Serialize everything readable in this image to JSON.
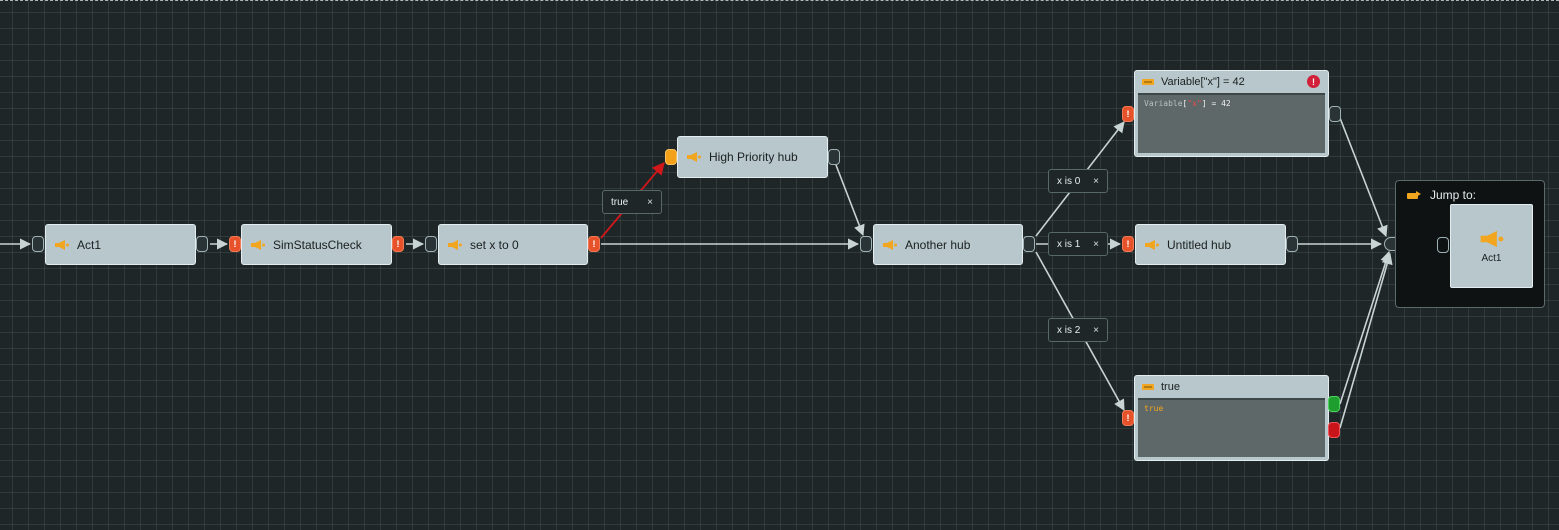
{
  "nodes": {
    "act1": "Act1",
    "sim_status_check": "SimStatusCheck",
    "set_x_to_0": "set x to 0",
    "high_priority_hub": "High Priority hub",
    "another_hub": "Another hub",
    "untitled_hub": "Untitled hub"
  },
  "condition_nodes": {
    "variable": {
      "title": "Variable[\"x\"] = 42",
      "code_keyword": "Variable",
      "code_bracket_open": "[",
      "code_string": "\"x\"",
      "code_rest": "] = 42"
    },
    "true_node": {
      "title": "true",
      "code": "true"
    }
  },
  "edge_labels": {
    "true": "true",
    "x_is_0": "x is 0",
    "x_is_1": "x is 1",
    "x_is_2": "x is 2",
    "close_symbol": "×"
  },
  "jump": {
    "title": "Jump to:",
    "target": "Act1"
  },
  "port_error_symbol": "!",
  "colors": {
    "canvas": "#1f2628",
    "node": "#b7c7cb",
    "error_port": "#e7522a",
    "active_edge": "#d0171a",
    "edge": "#c8d3d4",
    "green_output": "#1d9e2f",
    "red_output": "#c9141a",
    "icon_accent": "#f2a51f"
  }
}
